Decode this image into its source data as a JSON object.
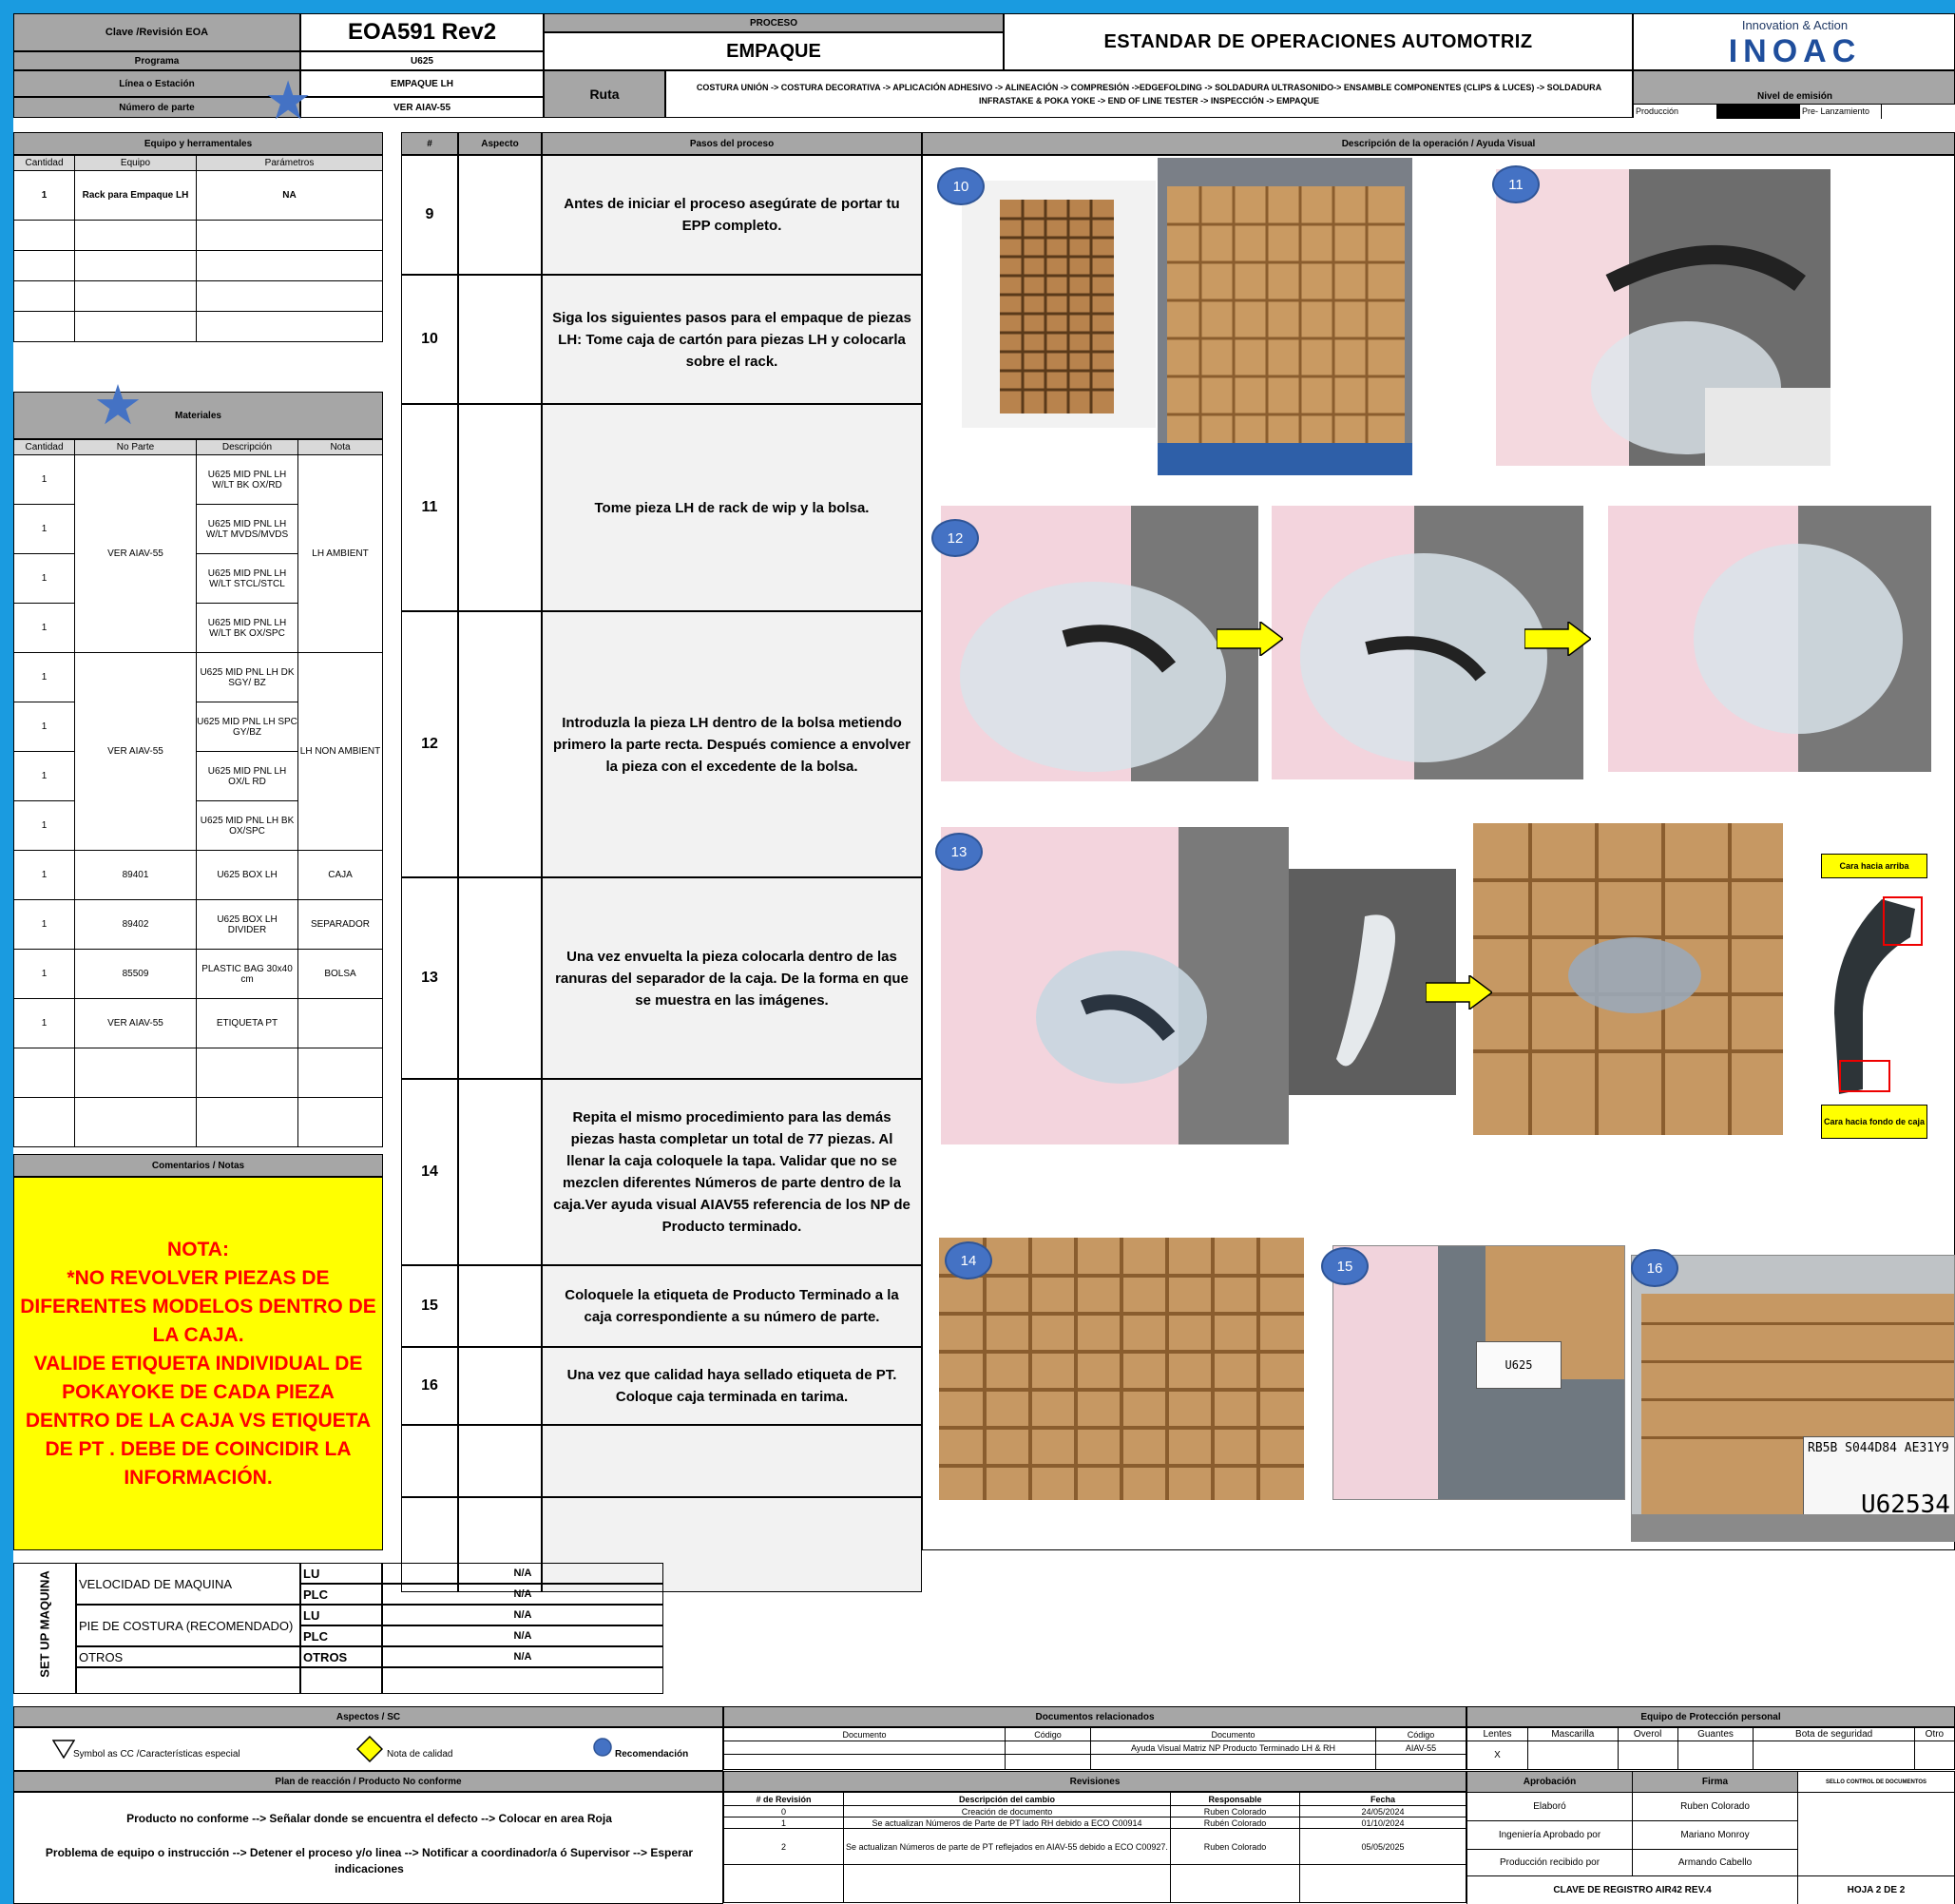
{
  "header": {
    "clave_label": "Clave /Revisión EOA",
    "clave_value": "EOA591 Rev2",
    "programa_label": "Programa",
    "programa_value": "U625",
    "linea_label": "Línea o Estación",
    "linea_value": "EMPAQUE LH",
    "numparte_label": "Número de parte",
    "numparte_value": "VER AIAV-55",
    "proceso_label": "PROCESO",
    "proceso_value": "EMPAQUE",
    "title": "ESTANDAR DE OPERACIONES AUTOMOTRIZ",
    "ruta_label": "Ruta",
    "ruta_value": "COSTURA UNIÓN -> COSTURA DECORATIVA -> APLICACIÓN ADHESIVO -> ALINEACIÓN -> COMPRESIÓN ->EDGEFOLDING -> SOLDADURA ULTRASONIDO-> ENSAMBLE COMPONENTES (CLIPS & LUCES) -> SOLDADURA INFRASTAKE & POKA YOKE -> END OF LINE TESTER -> INSPECCIÓN -> EMPAQUE",
    "logo_tagline": "Innovation & Action",
    "logo_text": "INOAC",
    "nivel_label": "Nivel de emisión",
    "nivel_produccion": "Producción",
    "nivel_prelanzamiento": "Pre- Lanzamiento"
  },
  "equipo": {
    "title": "Equipo y herramentales",
    "headers": [
      "Cantidad",
      "Equipo",
      "Parámetros"
    ],
    "rows": [
      [
        "1",
        "Rack para Empaque LH",
        "NA"
      ],
      [
        "",
        "",
        ""
      ],
      [
        "",
        "",
        ""
      ],
      [
        "",
        "",
        ""
      ],
      [
        "",
        "",
        ""
      ]
    ]
  },
  "materiales": {
    "title": "Materiales",
    "headers": [
      "Cantidad",
      "No Parte",
      "Descripción",
      "Nota"
    ],
    "group1_part": "VER AIAV-55",
    "group1_note": "LH AMBIENT",
    "group1_rows": [
      [
        "1",
        "U625 MID PNL LH W/LT BK OX/RD"
      ],
      [
        "1",
        "U625 MID PNL LH W/LT MVDS/MVDS"
      ],
      [
        "1",
        "U625 MID PNL LH W/LT STCL/STCL"
      ],
      [
        "1",
        "U625 MID PNL LH W/LT BK OX/SPC"
      ]
    ],
    "group2_part": "VER AIAV-55",
    "group2_note": "LH NON AMBIENT",
    "group2_rows": [
      [
        "1",
        "U625 MID PNL LH DK SGY/ BZ"
      ],
      [
        "1",
        "U625 MID PNL LH SPC GY/BZ"
      ],
      [
        "1",
        "U625 MID PNL LH OX/L RD"
      ],
      [
        "1",
        "U625 MID PNL LH BK OX/SPC"
      ]
    ],
    "other_rows": [
      [
        "1",
        "89401",
        "U625 BOX LH",
        "CAJA"
      ],
      [
        "1",
        "89402",
        "U625 BOX LH DIVIDER",
        "SEPARADOR"
      ],
      [
        "1",
        "85509",
        "PLASTIC BAG 30x40 cm",
        "BOLSA"
      ],
      [
        "1",
        "VER AIAV-55",
        "ETIQUETA PT",
        ""
      ],
      [
        "",
        "",
        "",
        ""
      ],
      [
        "",
        "",
        "",
        ""
      ]
    ]
  },
  "comentarios": {
    "title": "Comentarios / Notas",
    "note": "NOTA:\n*NO REVOLVER PIEZAS DE DIFERENTES MODELOS DENTRO DE LA CAJA.\nVALIDE ETIQUETA INDIVIDUAL DE POKAYOKE DE CADA PIEZA DENTRO DE LA CAJA VS ETIQUETA DE PT . DEBE DE COINCIDIR LA INFORMACIÓN."
  },
  "pasos": {
    "headers": [
      "#",
      "Aspecto",
      "Pasos del proceso",
      "Descripción de la operación / Ayuda Visual"
    ],
    "rows": [
      {
        "n": "9",
        "text": "Antes de iniciar el proceso asegúrate de portar tu EPP completo."
      },
      {
        "n": "10",
        "text": "Siga los siguientes pasos para el empaque de piezas LH: Tome caja de cartón para piezas LH y colocarla sobre el rack."
      },
      {
        "n": "11",
        "text": "Tome pieza LH de rack de wip y la bolsa."
      },
      {
        "n": "12",
        "text": "Introduzla la pieza LH dentro de la bolsa metiendo primero la parte recta. Después comience a envolver la pieza con el excedente de la bolsa."
      },
      {
        "n": "13",
        "text": "Una vez envuelta la pieza colocarla dentro de las ranuras del separador de la caja. De la forma en que se muestra en las imágenes."
      },
      {
        "n": "14",
        "text": "Repita el mismo procedimiento para las demás piezas hasta completar un total de 77 piezas. Al llenar la caja coloquele la tapa. Validar que no se mezclen diferentes Números de parte dentro de la caja.Ver ayuda visual AIAV55 referencia de los NP de Producto terminado."
      },
      {
        "n": "15",
        "text": "Coloquele la etiqueta de Producto Terminado a la caja correspondiente a su número de parte."
      },
      {
        "n": "16",
        "text": "Una vez que calidad haya sellado etiqueta de PT. Coloque caja terminada en tarima."
      },
      {
        "n": "",
        "text": ""
      },
      {
        "n": "",
        "text": ""
      }
    ]
  },
  "visual": {
    "badges": [
      "10",
      "11",
      "12",
      "13",
      "14",
      "15",
      "16"
    ],
    "cara_arriba": "Cara hacia arriba",
    "cara_fondo": "Cara hacia fondo de caja",
    "label_u625": "U625",
    "label_code": "RB5B S044D84 AE31Y9",
    "label_big": "U62534"
  },
  "setup": {
    "side_label": "SET UP MAQUINA",
    "rows": [
      {
        "name": "VELOCIDAD DE MAQUINA",
        "sub": "LU",
        "val": "N/A"
      },
      {
        "name": "",
        "sub": "PLC",
        "val": "N/A"
      },
      {
        "name": "PIE DE COSTURA (RECOMENDADO)",
        "sub": "LU",
        "val": "N/A"
      },
      {
        "name": "",
        "sub": "PLC",
        "val": "N/A"
      },
      {
        "name": "OTROS",
        "sub": "OTROS",
        "val": "N/A"
      },
      {
        "name": "",
        "sub": "",
        "val": ""
      }
    ]
  },
  "aspectos": {
    "title": "Aspectos / SC",
    "symbol_cc": "Symbol as  CC /Características especial",
    "nota_calidad": "Nota de calidad",
    "recomendacion": "Recomendación"
  },
  "docs": {
    "title": "Documentos relacionados",
    "headers": [
      "Documento",
      "Código",
      "Documento",
      "Código"
    ],
    "row": [
      "",
      "",
      "Ayuda Visual Matriz NP Producto Terminado LH & RH",
      "AIAV-55"
    ]
  },
  "epp": {
    "title": "Equipo de Protección personal",
    "headers": [
      "Lentes",
      "Mascarilla",
      "Overol",
      "Guantes",
      "Bota de seguridad",
      "Otro"
    ],
    "marks": [
      "X",
      "",
      "",
      "",
      "",
      ""
    ]
  },
  "plan": {
    "title": "Plan de reacción / Producto No conforme",
    "line1": "Producto no conforme --> Señalar donde se encuentra el defecto --> Colocar en area Roja",
    "line2": "Problema de equipo o instrucción --> Detener el proceso y/o linea --> Notificar a coordinador/a ó Supervisor --> Esperar indicaciones"
  },
  "revisiones": {
    "title": "Revisiones",
    "headers": [
      "# de Revisión",
      "Descripción del cambio",
      "Responsable",
      "Fecha"
    ],
    "rows": [
      [
        "0",
        "Creación de documento",
        "Ruben Colorado",
        "24/05/2024"
      ],
      [
        "1",
        "Se actualizan Números de Parte de PT lado RH debido a ECO C00914",
        "Rubén Colorado",
        "01/10/2024"
      ],
      [
        "2",
        "Se actualizan Números de parte de PT reflejados en AIAV-55 debido a ECO C00927.",
        "Ruben Colorado",
        "05/05/2025"
      ]
    ]
  },
  "aprobacion": {
    "headers": [
      "Aprobación",
      "Firma"
    ],
    "sello": "SELLO CONTROL DE DOCUMENTOS",
    "rows": [
      [
        "Elaboró",
        "Ruben Colorado"
      ],
      [
        "Ingeniería Aprobado por",
        "Mariano Monroy"
      ],
      [
        "Producción recibido por",
        "Armando Cabello"
      ]
    ],
    "clave": "CLAVE DE REGISTRO  AIR42  REV.4",
    "hoja": "HOJA 2 DE 2"
  }
}
